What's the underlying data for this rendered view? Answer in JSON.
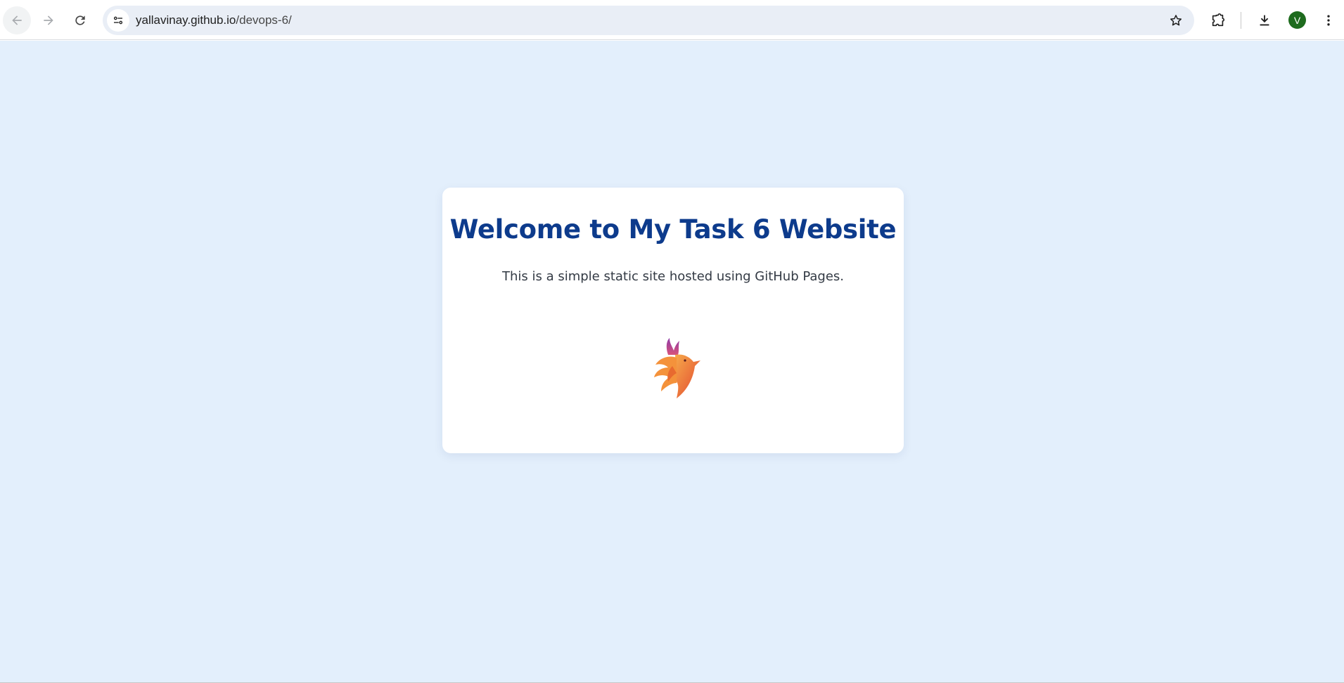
{
  "browser": {
    "url_host": "yallavinay.github.io",
    "url_path": "/devops-6/",
    "avatar_letter": "V",
    "icons": [
      "back-arrow-icon",
      "forward-arrow-icon",
      "reload-icon",
      "site-info-icon",
      "star-icon",
      "extensions-icon",
      "download-icon",
      "menu-dots-icon"
    ]
  },
  "page": {
    "heading": "Welcome to My Task 6 Website",
    "subtitle": "This is a simple static site hosted using GitHub Pages.",
    "logo": "phoenix-bird-logo"
  },
  "colors": {
    "page_background": "#e3effc",
    "heading": "#0d3b8c",
    "avatar": "#1e6b1e"
  }
}
